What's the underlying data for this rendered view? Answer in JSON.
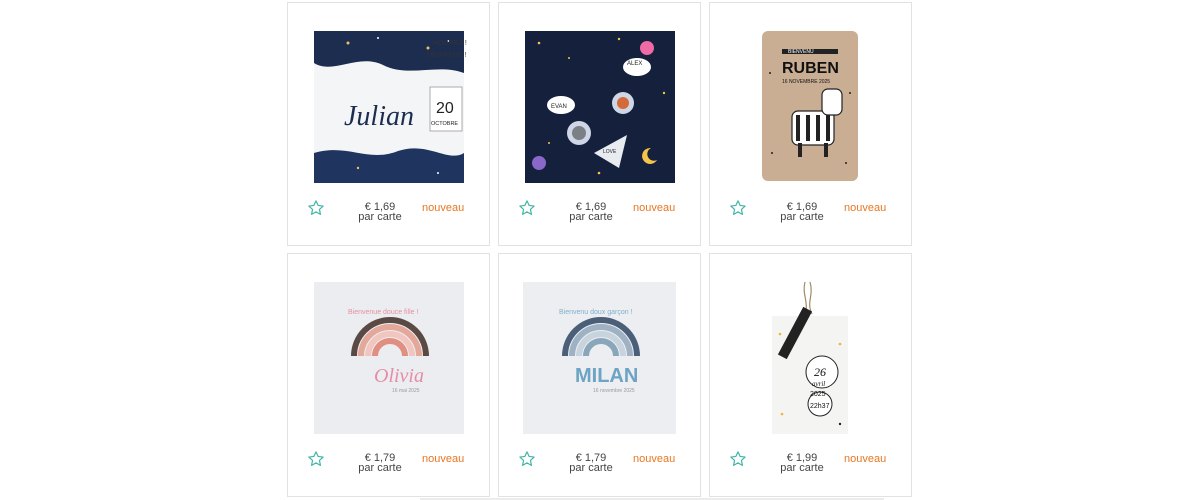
{
  "colors": {
    "star": "#3fb6a8",
    "badge": "#e87722",
    "border": "#e2e2e2"
  },
  "products": [
    {
      "price": "€ 1,69",
      "unit": "par carte",
      "badge": "nouveau",
      "art": {
        "line1": "HOURRA !",
        "line2": "UN FRÈRE !",
        "name": "Julian",
        "day": "20",
        "month": "OCTOBRE"
      }
    },
    {
      "price": "€ 1,69",
      "unit": "par carte",
      "badge": "nouveau",
      "art": {
        "bubble1": "ALEX",
        "bubble2": "EVAN",
        "cone": "LOVE"
      }
    },
    {
      "price": "€ 1,69",
      "unit": "par carte",
      "badge": "nouveau",
      "art": {
        "welcome": "BIENVENU",
        "name": "RUBEN",
        "date": "16 NOVEMBRE 2025"
      }
    },
    {
      "price": "€ 1,79",
      "unit": "par carte",
      "badge": "nouveau",
      "art": {
        "greeting": "Bienvenue douce fille !",
        "name": "Olivia",
        "date": "16 mai 2025"
      }
    },
    {
      "price": "€ 1,79",
      "unit": "par carte",
      "badge": "nouveau",
      "art": {
        "greeting": "Bienvenu doux garçon !",
        "name": "MILAN",
        "date": "16 novembre 2025"
      }
    },
    {
      "price": "€ 1,99",
      "unit": "par carte",
      "badge": "nouveau",
      "art": {
        "day": "26",
        "month": "avril",
        "year": "2025",
        "time": "22h37"
      }
    }
  ]
}
